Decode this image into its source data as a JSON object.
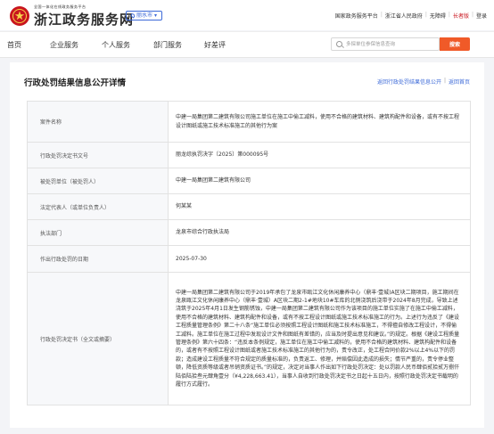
{
  "header": {
    "logo_subtitle": "全国一体化在线政务服务平台",
    "logo_title": "浙江政务服务网",
    "region_label": "丽水市",
    "top_links": [
      "国家政务服务平台",
      "浙江省人民政府",
      "无障碍",
      "长者版",
      "登录"
    ]
  },
  "nav": {
    "items": [
      "首页",
      "企业服务",
      "个人服务",
      "部门服务",
      "好差评"
    ],
    "search_placeholder": "多探单位参保信息查询",
    "search_button": "搜索"
  },
  "page": {
    "title": "行政处罚结果信息公开详情",
    "back_link_list": "返回行政处罚结果信息公开",
    "back_link_home": "返回首页"
  },
  "details": [
    {
      "key": "案件名称",
      "value": "中建一局集团第二建筑有限公司施工单位在施工中偷工减料，使用不合格的建筑材料、建筑构配件和设备，或有不按工程设计图纸或施工技术标准施工的其他行为案"
    },
    {
      "key": "行政处罚决定书文号",
      "value": "丽龙综执罚决字〔2025〕第000095号"
    },
    {
      "key": "被处罚单位（被处罚人）",
      "value": "中建一局集团第二建筑有限公司"
    },
    {
      "key": "法定代表人（或单位负责人）",
      "value": "何某某"
    },
    {
      "key": "执法部门",
      "value": "龙泉市综合行政执法局"
    },
    {
      "key": "作出行政处罚的日期",
      "value": "2025-07-30"
    },
    {
      "key": "行政处罚决定书（全文或摘要）",
      "value": "中建一局集团第二建筑有限公司于2019年承包了龙泉市瓯江文化休闲康养中心（鼎丰·壹城)A区块二期项目，施工期间在龙泉瓯江文化休闲康养中心（鼎丰·壹城）A区块二期2-1#地块10#车库的北侧浇筑后浇带于2024年8月完成，导致上述浇筑于2025年4月1日发生钢筋锈蚀，中建一局集团第二建筑有限公司作为该项目的施工单位实施了在施工中偷工减料，使用不合格的建筑材料、建筑构配件和设备，或有不按工程设计图纸或施工技术标准施工的行为。上述行为违反了《建设工程质量管理条例》第二十八条“施工单位必须按照工程设计图纸和施工技术标准施工，不得擅自修改工程设计，不得偷工减料。施工单位在施工过程中发现设计文件和图纸有差错的，应当及时提出意见和建议。”的规定。根据《建设工程质量管理条例》第六十四条：“违反本条例规定，施工单位在施工中偷工减料的，使用不合格的建筑材料、建筑构配件和设备的，或者有不按照工程设计图纸或者施工技术标准施工的其他行为的，责令改正，处工程合同价款2%以上4%以下的罚款；造成建设工程质量不符合规定的质量标准的，负责返工、修理，并赔偿因此造成的损失；情节严重的，责令停业整顿，降低资质等级或者吊销资质证书。”的规定，决定对当事人作出如下行政处罚决定：处以罚款人民币肆佰贰拾贰万捌仟陆佰陆拾叁元肆角壹分（¥4,228,663.41），当事人自收到行政处罚决定书之日起十五日内，按照行政处罚决定书载明的履行方式履行。"
    }
  ],
  "colors": {
    "brand_red": "#c9151e",
    "accent_blue": "#3d6ad8",
    "search_orange": "#f05a28"
  }
}
